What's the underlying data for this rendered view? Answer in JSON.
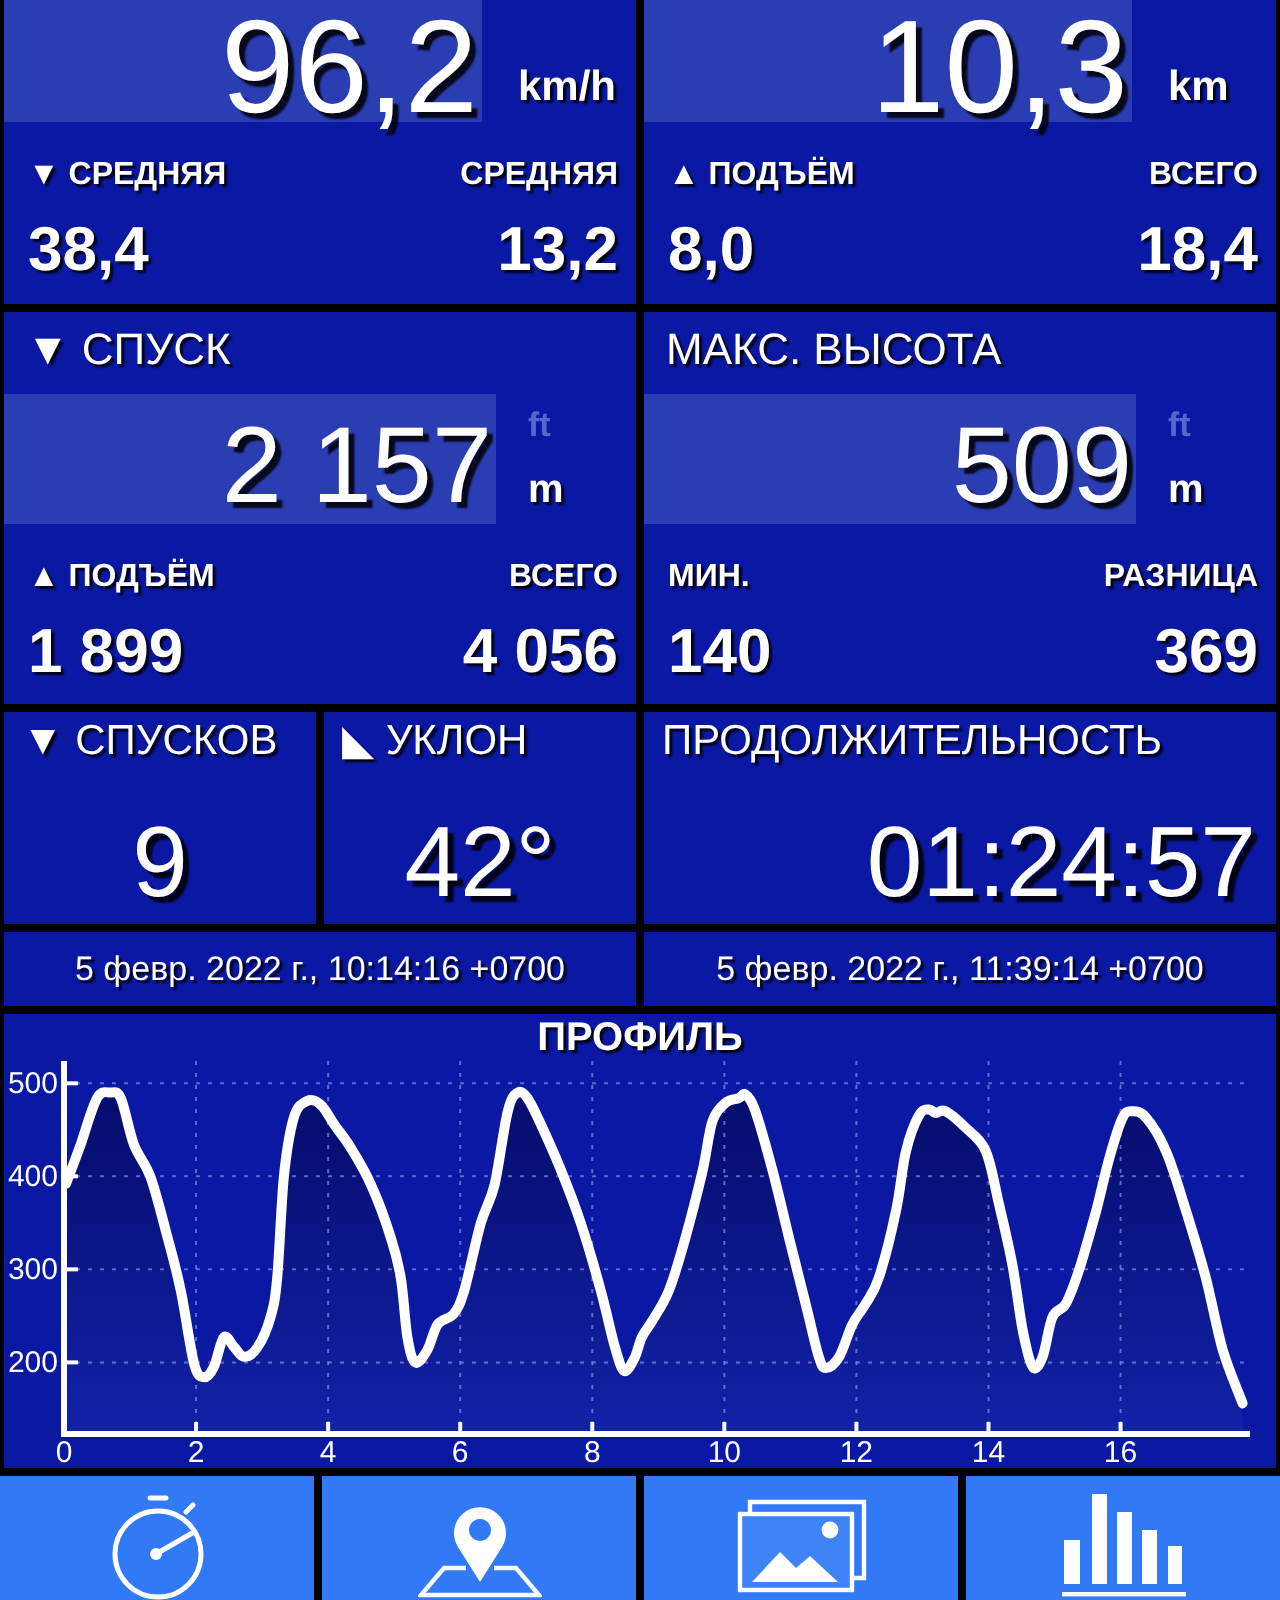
{
  "speed_distance_cards": [
    {
      "value": "96,2",
      "unit": "km/h",
      "stats": [
        {
          "label": "▼ СРЕДНЯЯ",
          "value": "38,4"
        },
        {
          "label": "СРЕДНЯЯ",
          "value": "13,2"
        }
      ]
    },
    {
      "value": "10,3",
      "unit": "km",
      "stats": [
        {
          "label": "▲ ПОДЪЁМ",
          "value": "8,0"
        },
        {
          "label": "ВСЕГО",
          "value": "18,4"
        }
      ]
    }
  ],
  "altitude_cards": [
    {
      "title": "▼ СПУСК",
      "value": "2 157",
      "alt_unit": "ft",
      "unit": "m",
      "stats": [
        {
          "label": "▲ ПОДЪЁМ",
          "value": "1 899"
        },
        {
          "label": "ВСЕГО",
          "value": "4 056"
        }
      ]
    },
    {
      "title": "МАКС. ВЫСОТА",
      "value": "509",
      "alt_unit": "ft",
      "unit": "m",
      "stats": [
        {
          "label": "МИН.",
          "value": "140"
        },
        {
          "label": "РАЗНИЦА",
          "value": "369"
        }
      ]
    }
  ],
  "counters": [
    {
      "title": "▼ СПУСКОВ",
      "value": "9"
    },
    {
      "title": "◣ УКЛОН",
      "value": "42°"
    }
  ],
  "duration": {
    "title": "ПРОДОЛЖИТЕЛЬНОСТЬ",
    "value": "01:24:57"
  },
  "timestamps": [
    "5 февр. 2022 г., 10:14:16 +0700",
    "5 февр. 2022 г., 11:39:14 +0700"
  ],
  "profile": {
    "chart_data": {
      "type": "area",
      "title": "ПРОФИЛЬ",
      "grid": true,
      "x": [
        0.03,
        0.25,
        0.5,
        0.7,
        0.86,
        1.06,
        1.31,
        1.57,
        1.77,
        1.97,
        2.12,
        2.27,
        2.42,
        2.58,
        2.73,
        2.93,
        3.13,
        3.23,
        3.33,
        3.48,
        3.68,
        3.89,
        4.09,
        4.34,
        4.65,
        4.95,
        5.1,
        5.2,
        5.32,
        5.5,
        5.66,
        5.9,
        6.06,
        6.31,
        6.52,
        6.72,
        6.87,
        7.02,
        7.22,
        7.53,
        7.83,
        8.13,
        8.33,
        8.48,
        8.64,
        8.75,
        8.91,
        9.16,
        9.41,
        9.67,
        9.82,
        10.02,
        10.22,
        10.32,
        10.47,
        10.73,
        10.98,
        11.23,
        11.43,
        11.54,
        11.74,
        11.94,
        12.14,
        12.34,
        12.6,
        12.75,
        12.95,
        13.1,
        13.2,
        13.35,
        13.66,
        13.96,
        14.16,
        14.36,
        14.52,
        14.67,
        14.82,
        14.97,
        15.17,
        15.37,
        15.63,
        15.83,
        16.03,
        16.18,
        16.39,
        16.69,
        16.99,
        17.29,
        17.55,
        17.85
      ],
      "values": [
        392,
        434,
        484,
        490,
        484,
        434,
        399,
        334,
        277,
        199,
        184,
        195,
        227,
        216,
        206,
        216,
        249,
        291,
        399,
        463,
        481,
        477,
        456,
        431,
        391,
        334,
        291,
        227,
        200,
        213,
        241,
        252,
        277,
        349,
        391,
        470,
        490,
        484,
        456,
        406,
        349,
        277,
        220,
        191,
        205,
        227,
        245,
        277,
        334,
        406,
        459,
        479,
        484,
        488,
        470,
        406,
        334,
        263,
        206,
        194,
        206,
        241,
        263,
        291,
        363,
        427,
        466,
        472,
        468,
        470,
        452,
        427,
        370,
        306,
        234,
        195,
        206,
        249,
        263,
        299,
        363,
        420,
        463,
        470,
        463,
        427,
        363,
        291,
        213,
        156
      ],
      "xlim": [
        0,
        17.9
      ],
      "ylim": [
        123,
        524
      ],
      "xticks": [
        0,
        2,
        4,
        6,
        8,
        10,
        12,
        14,
        16
      ],
      "yticks": [
        200,
        300,
        400,
        500
      ]
    }
  }
}
